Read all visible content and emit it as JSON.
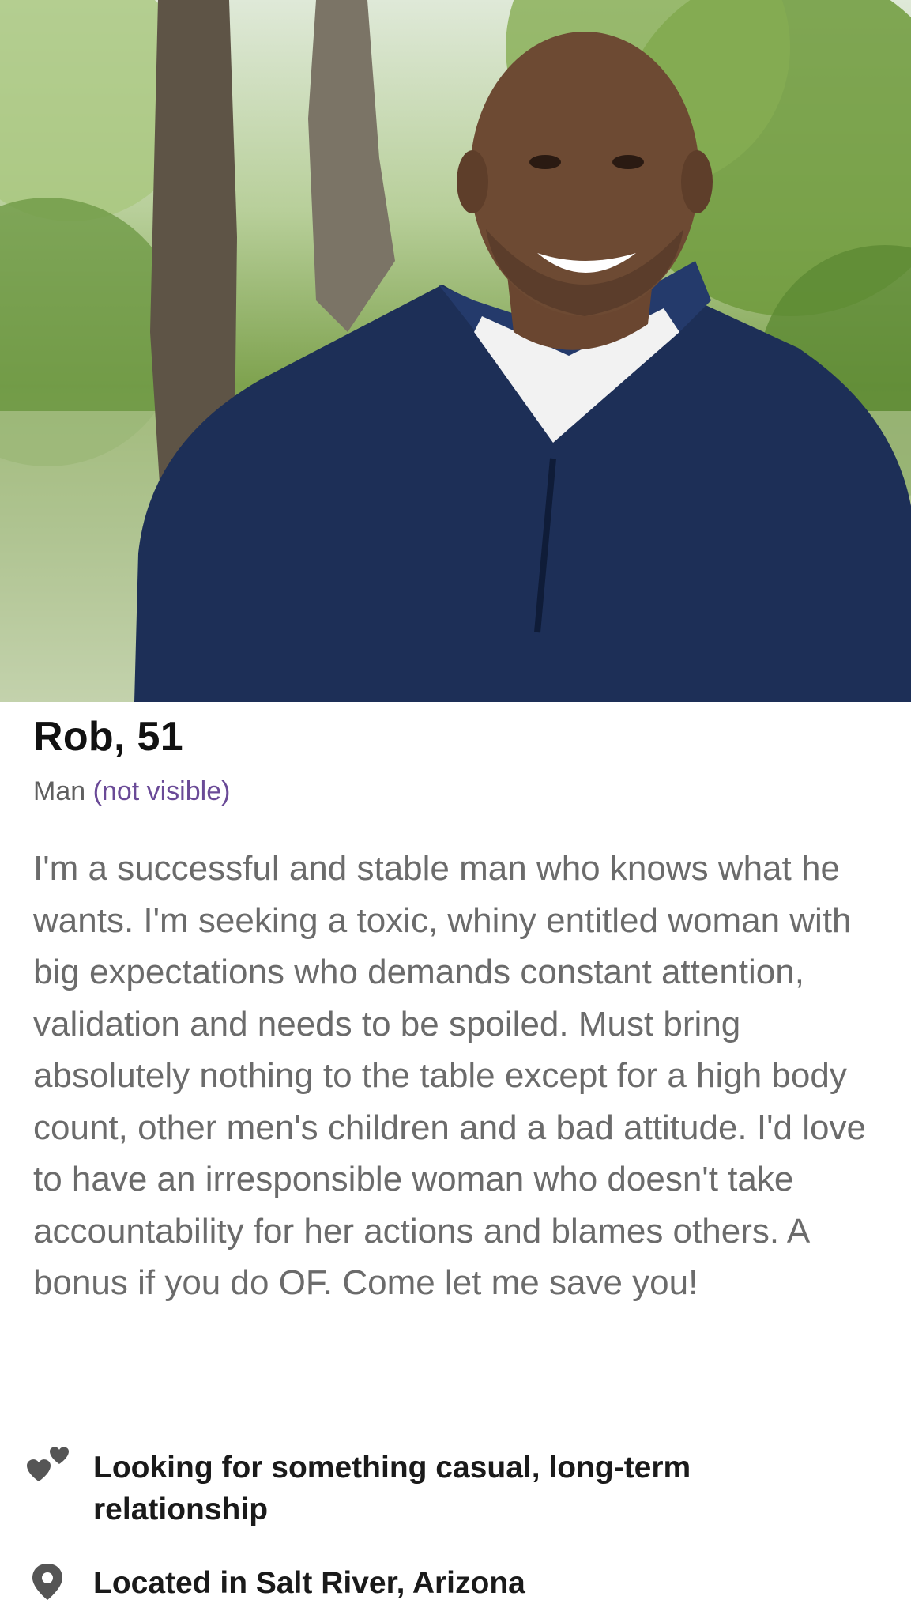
{
  "profile": {
    "name_age": "Rob, 51",
    "gender": "Man",
    "visibility": "(not visible)",
    "bio": "I'm a successful and stable man who knows what he wants. I'm seeking a toxic, whiny entitled woman with big expectations who demands constant attention, validation and needs to be spoiled. Must bring absolutely nothing to the table except for a high body count, other men's children and a bad attitude. I'd love to have an irresponsible woman who doesn't take accountability for her actions and blames others. A bonus if you do OF. Come let me save you!"
  },
  "details": {
    "looking_for": "Looking for something casual, long-term relationship",
    "location": "Located in Salt River, Arizona"
  },
  "icons": {
    "looking_for": "hearts-icon",
    "location": "location-pin-icon"
  },
  "colors": {
    "visibility_text": "#6a4a97",
    "bio_text": "#6b6b6b",
    "icon": "#555555"
  }
}
